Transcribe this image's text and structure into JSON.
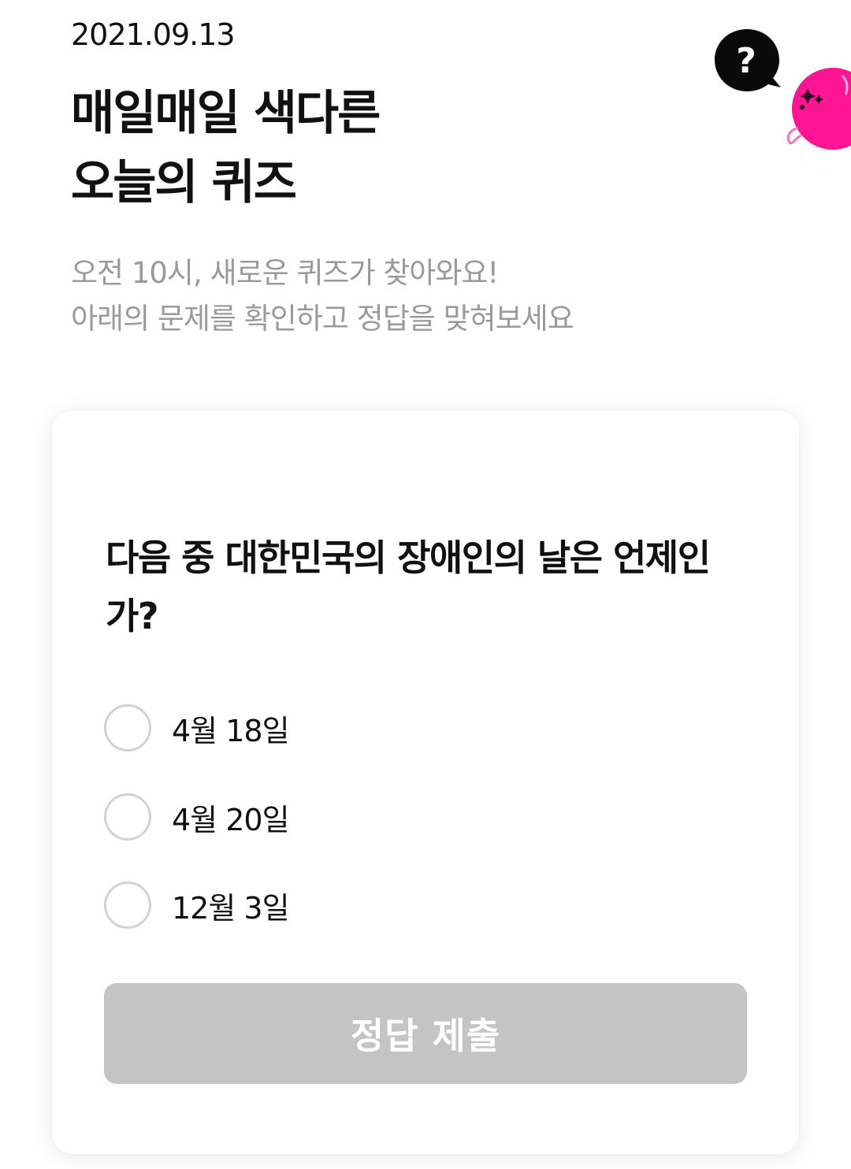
{
  "header": {
    "date": "2021.09.13",
    "title_line1": "매일매일 색다른",
    "title_line2": "오늘의 퀴즈",
    "subtitle_line1": "오전 10시, 새로운 퀴즈가 찾아와요!",
    "subtitle_line2": "아래의 문제를 확인하고 정답을 맞혀보세요"
  },
  "mascot": {
    "bubble_icon": "question-bubble-icon",
    "bubble_glyph": "?",
    "character_icon": "pink-mascot-icon",
    "accent_color": "#ff1493"
  },
  "quiz": {
    "question": "다음 중 대한민국의 장애인의 날은 언제인가?",
    "options": [
      {
        "label": "4월 18일",
        "selected": false
      },
      {
        "label": "4월 20일",
        "selected": false
      },
      {
        "label": "12월 3일",
        "selected": false
      }
    ],
    "submit_label": "정답 제출",
    "submit_enabled": false,
    "submit_color": "#c4c4c4"
  }
}
